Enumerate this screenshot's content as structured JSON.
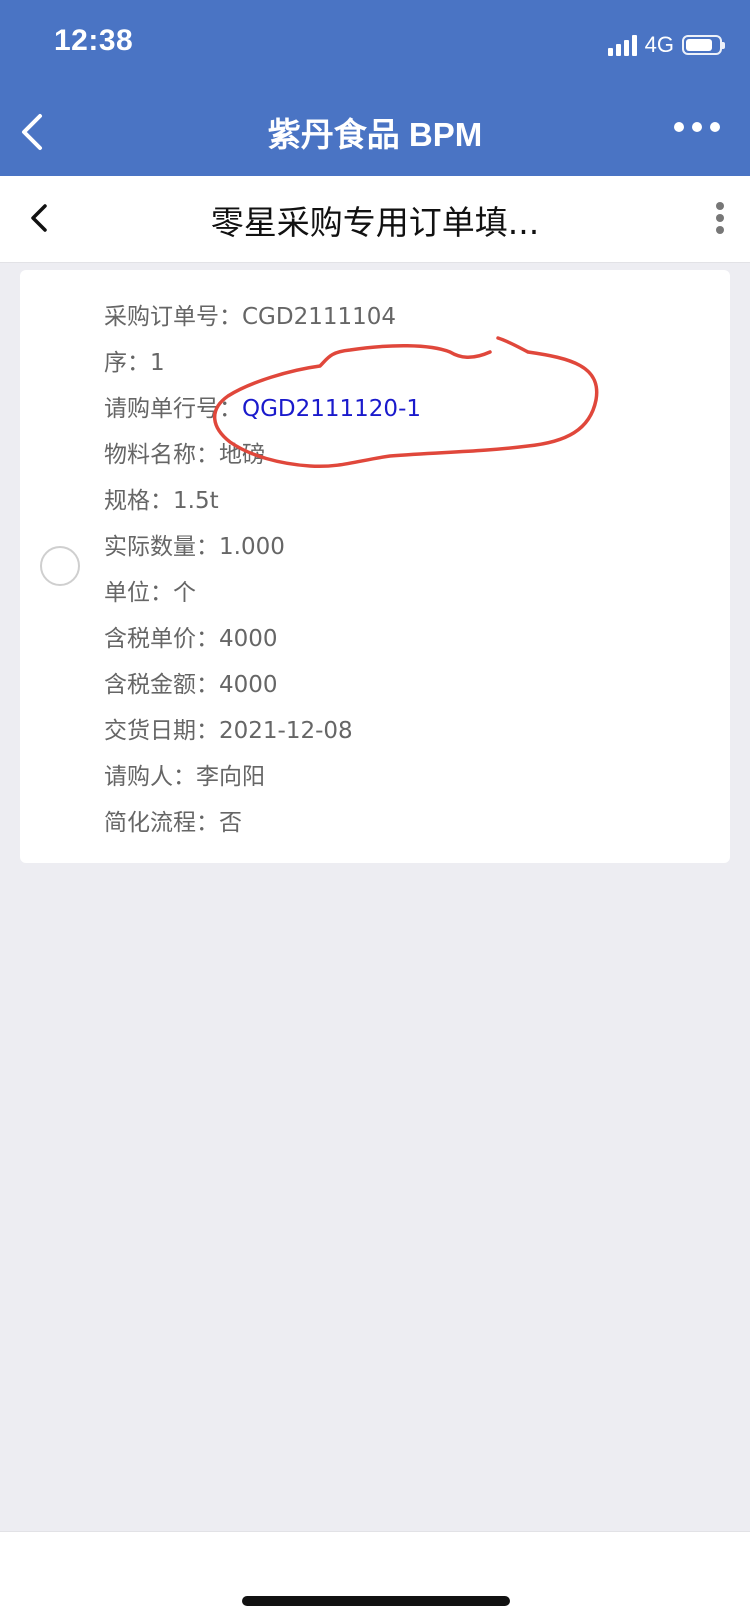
{
  "status_bar": {
    "time": "12:38",
    "network": "4G"
  },
  "nav": {
    "title": "紫丹食品 BPM"
  },
  "page": {
    "title": "零星采购专用订单填..."
  },
  "record": {
    "fields": [
      {
        "label": "采购订单号：",
        "value": "CGD2111104",
        "link": false
      },
      {
        "label": "序：",
        "value": "1",
        "link": false
      },
      {
        "label": "请购单行号：",
        "value": "QGD2111120-1",
        "link": true
      },
      {
        "label": "物料名称：",
        "value": "地磅",
        "link": false
      },
      {
        "label": "规格：",
        "value": "1.5t",
        "link": false
      },
      {
        "label": "实际数量：",
        "value": "1.000",
        "link": false
      },
      {
        "label": "单位：",
        "value": "个",
        "link": false
      },
      {
        "label": "含税单价：",
        "value": "4000",
        "link": false
      },
      {
        "label": "含税金额：",
        "value": "4000",
        "link": false
      },
      {
        "label": "交货日期：",
        "value": "2021-12-08",
        "link": false
      },
      {
        "label": "请购人：",
        "value": "李向阳",
        "link": false
      },
      {
        "label": "简化流程：",
        "value": "否",
        "link": false
      }
    ]
  },
  "colors": {
    "nav_bg": "#4A74C4",
    "link": "#1a1acc",
    "annotation": "#E0473B",
    "page_bg": "#EDEDF2"
  }
}
